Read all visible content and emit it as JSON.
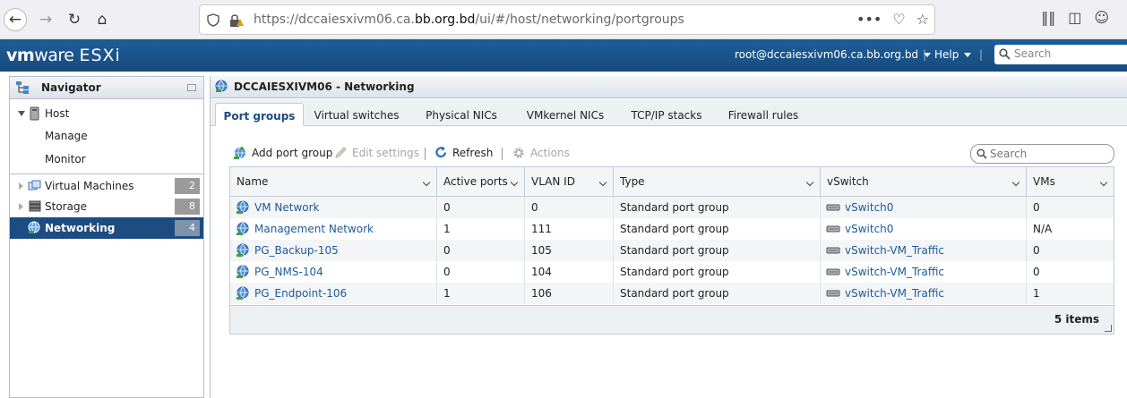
{
  "browser": {
    "url_prefix": "https://dccaiesxivm06.ca.",
    "url_domain": "bb.org.bd",
    "url_path": "/ui/#/host/networking/portgroups"
  },
  "header": {
    "logo_vm": "vm",
    "logo_ware": "ware",
    "logo_product": "ESXi",
    "user": "root@dccaiesxivm06.ca.bb.org.bd",
    "help": "Help",
    "search_placeholder": "Search"
  },
  "navigator": {
    "title": "Navigator",
    "host": "Host",
    "manage": "Manage",
    "monitor": "Monitor",
    "items": [
      {
        "label": "Virtual Machines",
        "count": "2"
      },
      {
        "label": "Storage",
        "count": "8"
      },
      {
        "label": "Networking",
        "count": "4"
      }
    ]
  },
  "content": {
    "title": "DCCAIESXIVM06 - Networking",
    "tabs": [
      "Port groups",
      "Virtual switches",
      "Physical NICs",
      "VMkernel NICs",
      "TCP/IP stacks",
      "Firewall rules"
    ],
    "toolbar": {
      "add": "Add port group",
      "edit": "Edit settings",
      "refresh": "Refresh",
      "actions": "Actions"
    },
    "search_placeholder": "Search",
    "columns": [
      "Name",
      "Active ports",
      "VLAN ID",
      "Type",
      "vSwitch",
      "VMs"
    ],
    "rows": [
      {
        "name": "VM Network",
        "active": "0",
        "vlan": "0",
        "type": "Standard port group",
        "vswitch": "vSwitch0",
        "vms": "0"
      },
      {
        "name": "Management Network",
        "active": "1",
        "vlan": "111",
        "type": "Standard port group",
        "vswitch": "vSwitch0",
        "vms": "N/A"
      },
      {
        "name": "PG_Backup-105",
        "active": "0",
        "vlan": "105",
        "type": "Standard port group",
        "vswitch": "vSwitch-VM_Traffic",
        "vms": "0"
      },
      {
        "name": "PG_NMS-104",
        "active": "0",
        "vlan": "104",
        "type": "Standard port group",
        "vswitch": "vSwitch-VM_Traffic",
        "vms": "0"
      },
      {
        "name": "PG_Endpoint-106",
        "active": "1",
        "vlan": "106",
        "type": "Standard port group",
        "vswitch": "vSwitch-VM_Traffic",
        "vms": "1"
      }
    ],
    "item_count": "5 items"
  }
}
